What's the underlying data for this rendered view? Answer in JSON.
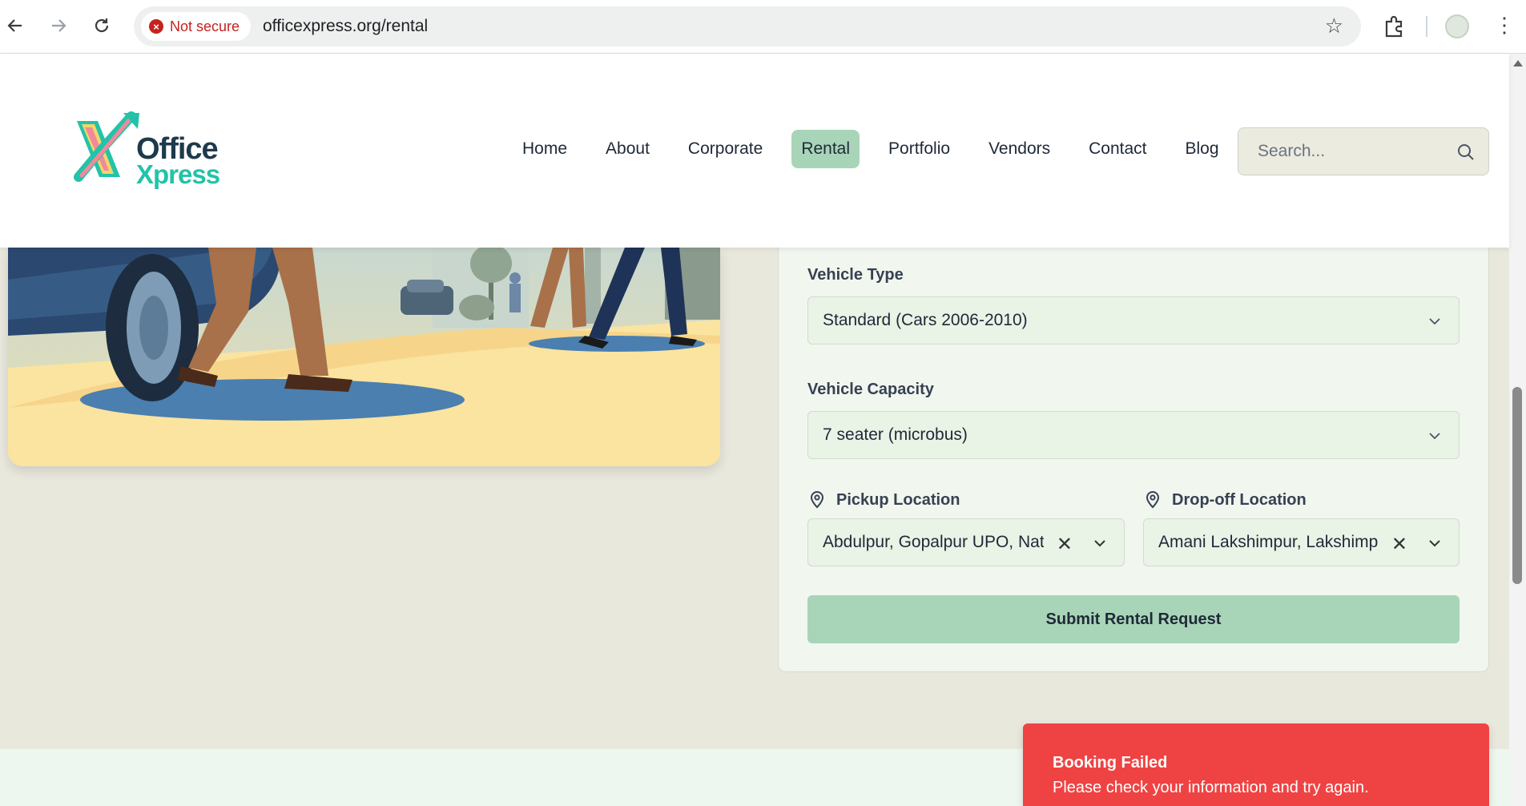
{
  "browser": {
    "security_label": "Not secure",
    "url": "officexpress.org/rental"
  },
  "site": {
    "logo_office": "Office",
    "logo_xpress": "Xpress",
    "nav": [
      {
        "label": "Home",
        "active": false
      },
      {
        "label": "About",
        "active": false
      },
      {
        "label": "Corporate",
        "active": false
      },
      {
        "label": "Rental",
        "active": true
      },
      {
        "label": "Portfolio",
        "active": false
      },
      {
        "label": "Vendors",
        "active": false
      },
      {
        "label": "Contact",
        "active": false
      },
      {
        "label": "Blog",
        "active": false
      }
    ],
    "search_placeholder": "Search..."
  },
  "form": {
    "vehicle_type_label": "Vehicle Type",
    "vehicle_type_value": "Standard (Cars 2006-2010)",
    "vehicle_capacity_label": "Vehicle Capacity",
    "vehicle_capacity_value": "7 seater (microbus)",
    "pickup_label": "Pickup Location",
    "pickup_value": "Abdulpur, Gopalpur UPO, Natore",
    "dropoff_label": "Drop-off Location",
    "dropoff_value": "Amani Lakshimpur, Lakshimpur",
    "submit_label": "Submit Rental Request"
  },
  "toast": {
    "title": "Booking Failed",
    "message": "Please check your information and try again."
  },
  "colors": {
    "accent_green": "#a8d5b8",
    "error_red": "#ef4343",
    "page_bg": "#e9e8dd"
  }
}
